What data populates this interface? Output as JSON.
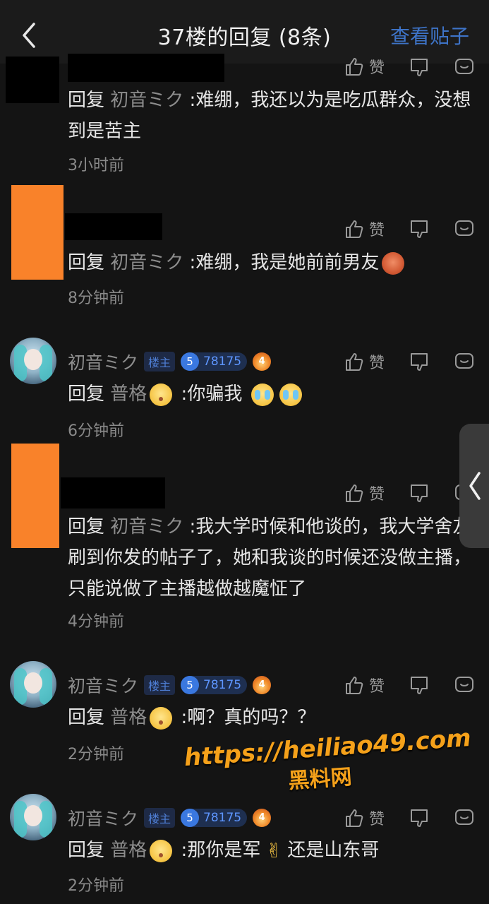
{
  "header": {
    "title": "37楼的回复 (8条)",
    "view_post": "查看贴子"
  },
  "labels": {
    "like": "赞",
    "owner_badge": "楼主",
    "reply_prefix": "回复"
  },
  "user": {
    "name": "初音ミク",
    "level": "5",
    "points": "78175",
    "fire_level": "4"
  },
  "comments": [
    {
      "reply_to": "初音ミク",
      "text": " :难绷，我还以为是吃瓜群众，没想到是苦主",
      "time": "3小时前"
    },
    {
      "reply_to": "初音ミク",
      "text": " :难绷，我是她前前男友",
      "time": "8分钟前"
    },
    {
      "reply_to": "普格",
      "text": " :你骗我",
      "time": "6分钟前"
    },
    {
      "reply_to": "初音ミク",
      "text": " :我大学时候和他谈的，我大学舍友刷到你发的帖子了，她和我谈的时候还没做主播，只能说做了主播越做越魔怔了",
      "time": "4分钟前"
    },
    {
      "reply_to": "普格",
      "text": " :啊？真的吗？？",
      "time": "2分钟前"
    },
    {
      "reply_to": "普格",
      "text_a": " :那你是军",
      "text_b": "还是山东哥",
      "time": "2分钟前"
    }
  ],
  "icons": [
    "back-arrow-icon",
    "thumbs-up-icon",
    "thumbs-down-icon",
    "comment-icon",
    "chevron-left-icon"
  ],
  "colors": {
    "accent": "#3e74c8",
    "background": "#141414",
    "watermark": "#f5a11a"
  },
  "watermark": {
    "url": "https://heiliao49.com",
    "name": "黑料网"
  }
}
